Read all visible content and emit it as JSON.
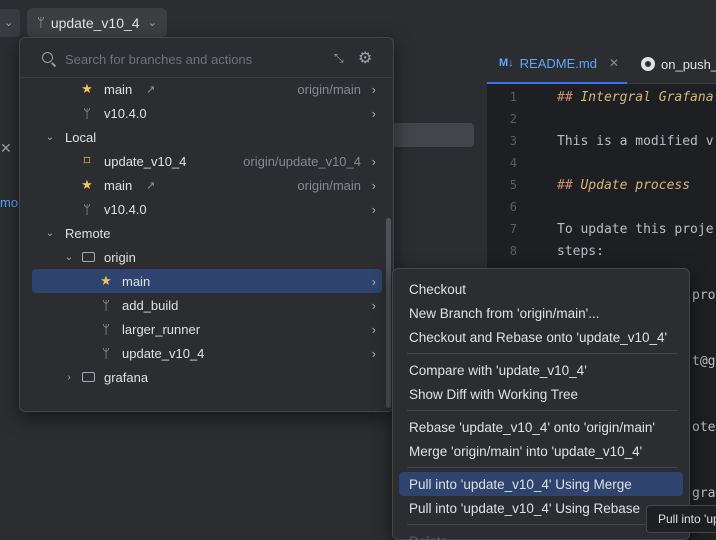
{
  "toolbar": {
    "branch_label": "update_v10_4"
  },
  "left_panel": {
    "fragment_text": "mo"
  },
  "editor": {
    "tabs": [
      {
        "label": "README.md",
        "badge": "M↓",
        "active": true
      },
      {
        "label": "on_push_",
        "active": false
      }
    ],
    "line_numbers": [
      "1",
      "2",
      "3",
      "4",
      "5",
      "6",
      "7",
      "8"
    ],
    "lines": [
      {
        "prefix": "## ",
        "text": "Intergral Grafana",
        "kind": "heading"
      },
      {
        "text": "",
        "kind": "plain"
      },
      {
        "text": "This is a modified v",
        "kind": "plain"
      },
      {
        "text": "",
        "kind": "plain"
      },
      {
        "prefix": "## ",
        "text": "Update process",
        "kind": "heading"
      },
      {
        "text": "",
        "kind": "plain"
      },
      {
        "text": "To update this proje",
        "kind": "plain"
      },
      {
        "text": "steps:",
        "kind": "plain"
      }
    ],
    "partial_text": {
      "pro": "pro",
      "at": "t@g",
      "ote": "ote",
      "graf": "graf"
    }
  },
  "branches_popup": {
    "search_placeholder": "Search for branches and actions",
    "rows": [
      {
        "name": "main",
        "icon": "star",
        "incoming": true,
        "tracking": "origin/main",
        "has_submenu": true
      },
      {
        "name": "v10.4.0",
        "icon": "branch",
        "tracking": "",
        "has_submenu": true
      },
      {
        "name": "Local",
        "icon": "none",
        "group": true,
        "expanded": true
      },
      {
        "name": "update_v10_4",
        "icon": "tag",
        "tracking": "origin/update_v10_4",
        "has_submenu": true
      },
      {
        "name": "main",
        "icon": "star",
        "incoming": true,
        "tracking": "origin/main",
        "has_submenu": true
      },
      {
        "name": "v10.4.0",
        "icon": "branch",
        "tracking": "",
        "has_submenu": true
      },
      {
        "name": "Remote",
        "icon": "none",
        "group": true,
        "expanded": true
      },
      {
        "name": "origin",
        "icon": "folder",
        "group": true,
        "expanded": true
      },
      {
        "name": "main",
        "icon": "star",
        "tracking": "",
        "has_submenu": true,
        "selected": true
      },
      {
        "name": "add_build",
        "icon": "branch",
        "tracking": "",
        "has_submenu": true
      },
      {
        "name": "larger_runner",
        "icon": "branch",
        "tracking": "",
        "has_submenu": true
      },
      {
        "name": "update_v10_4",
        "icon": "branch",
        "tracking": "",
        "has_submenu": true
      },
      {
        "name": "grafana",
        "icon": "folder",
        "group": true,
        "expanded": false
      }
    ]
  },
  "context_menu": {
    "items": [
      {
        "label": "Checkout"
      },
      {
        "label": "New Branch from 'origin/main'..."
      },
      {
        "label": "Checkout and Rebase onto 'update_v10_4'"
      },
      {
        "label": "Compare with 'update_v10_4'"
      },
      {
        "label": "Show Diff with Working Tree"
      },
      {
        "label": "Rebase 'update_v10_4' onto 'origin/main'"
      },
      {
        "label": "Merge 'origin/main' into 'update_v10_4'"
      },
      {
        "label": "Pull into 'update_v10_4' Using Merge",
        "highlighted": true
      },
      {
        "label": "Pull into 'update_v10_4' Using Rebase"
      },
      {
        "label": "Delete",
        "disabled": true
      }
    ]
  },
  "tooltip": {
    "text": "Pull into 'up"
  }
}
